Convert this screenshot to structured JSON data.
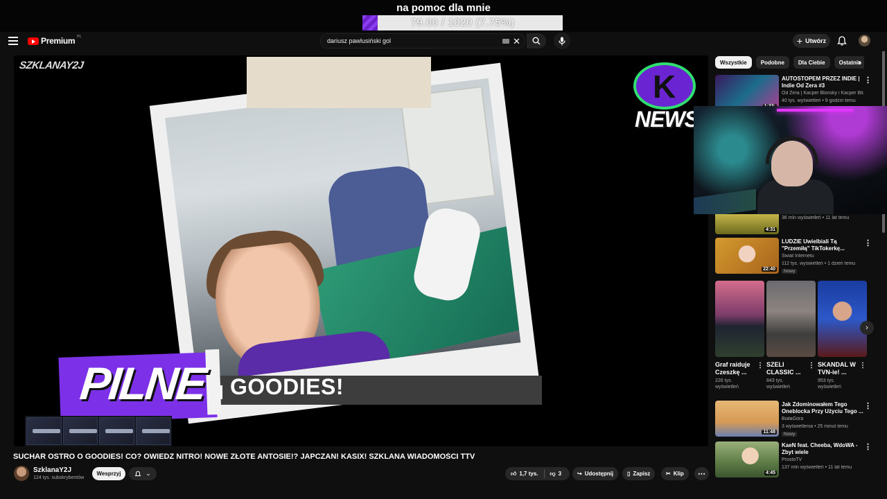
{
  "overlay": {
    "title": "na pomoc dla mnie",
    "goal_text": "79.00 / 1020 (7.75%)",
    "goal_fraction": 0.0775,
    "fill_color": "#8a3cf0"
  },
  "header": {
    "logo_text": "Premium",
    "logo_region": "PL",
    "search_value": "dariusz pawlusiński gol",
    "create_label": "Utwórz"
  },
  "player": {
    "watermark": "SZKLANAY2J",
    "ribbon_text": "GOODIES!",
    "pilne_text": "PILNE",
    "news_text": "NEWS",
    "news_letter": "K"
  },
  "video": {
    "title": "SUCHAR OSTRO O GOODIES! CO? OWIEDZ NITRO! NOWE ZŁOTE ANTOSIE!? JAPCZAN! KASIX! SZKLANA WIADOMOŚCI TTV",
    "channel": "SzklanaY2J",
    "subscribers": "124 tys. subskrybentów",
    "support_label": "Wesprzyj",
    "likes": "1,7 tys.",
    "dislikes": "3",
    "share_label": "Udostępnij",
    "save_label": "Zapisz",
    "clip_label": "Klip"
  },
  "sidebar": {
    "chips": [
      "Wszystkie",
      "Podobne",
      "Dla Ciebie",
      "Ostatnio"
    ],
    "recommendations": [
      {
        "title": "AUTOSTOPEM PRZEZ INDIE | Indie Od Zera #3",
        "channel": "Od Zera | Kacper Blonsky i Kacper Blons...",
        "meta": "40 tys. wyświetleń • 9 godzin temu",
        "duration": "1:33:"
      },
      {
        "title": "LUDZIE Uwielbiali Tą \"Przemiłą\" TikTokerkę... Dopóki nie ...",
        "channel": "Świat Internetu",
        "meta": "112 tys. wyświetleń • 1 dzień temu",
        "duration": "22:40",
        "badge": "Nowy"
      },
      {
        "title": "Jak Zdominowałem Tego Oneblocka Przy Użyciu Tego ...",
        "channel": "BialaGóra",
        "meta": "3 wyświetlenia • 25 minut temu",
        "duration": "11:48",
        "badge": "Nowy"
      },
      {
        "title": "KaeN feat. Cheeba, WdoWA - Zbyt wiele",
        "channel": "ProstoTV",
        "meta": "137 mln wyświetleń • 11 lat temu",
        "duration": "4:45"
      }
    ],
    "partial": {
      "meta": "36 mln wyświetleń • 11 lat temu",
      "duration": "4:31"
    },
    "shorts": [
      {
        "title": "Graf raiduje Czeszkę ...",
        "views": "226 tys. wyświetleń"
      },
      {
        "title": "SZELI CLASSIC ...",
        "views": "843 tys. wyświetleń"
      },
      {
        "title": "SKANDAL W TVN-ie! ...",
        "views": "953 tys. wyświetleń"
      }
    ]
  }
}
